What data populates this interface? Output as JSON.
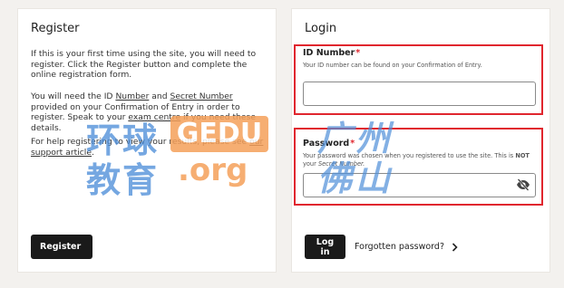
{
  "register": {
    "title": "Register",
    "para1": "If this is your first time using the site, you will need to register. Click the Register button and complete the online registration form.",
    "para2_a": "You will need the ID ",
    "para2_number": "Number",
    "para2_b": " and ",
    "para2_secret": "Secret Number",
    "para2_c": " provided on your Confirmation of Entry in order to register. Speak to your ",
    "para2_link": "exam centre",
    "para2_d": " if you need these details.",
    "para3_a": "For help registering to view your results, please see ",
    "para3_link": "our support article",
    "para3_b": ".",
    "button_label": "Register"
  },
  "login": {
    "title": "Login",
    "id_label": "ID Number",
    "id_required": "*",
    "id_hint": "Your ID number can be found on your Confirmation of Entry.",
    "id_value": "",
    "password_label": "Password",
    "password_required": "*",
    "password_hint_a": "Your password was chosen when you registered to use the site. This is ",
    "password_hint_not": "NOT",
    "password_hint_b": " your ",
    "password_hint_secret": "Secret Number",
    "password_hint_c": ".",
    "password_value": "",
    "login_button": "Log in",
    "forgot_label": "Forgotten password?"
  },
  "watermark": {
    "line1": "环球",
    "gedu": "GEDU",
    "line2": "教育",
    "org": ".org",
    "right1": "广州",
    "right2": "佛山"
  },
  "colors": {
    "highlight": "#e0262e",
    "button": "#1a1a1a",
    "background": "#f3f1ee"
  },
  "icons": {
    "chevron": "chevron-right-icon",
    "eye": "eye-off-icon"
  }
}
